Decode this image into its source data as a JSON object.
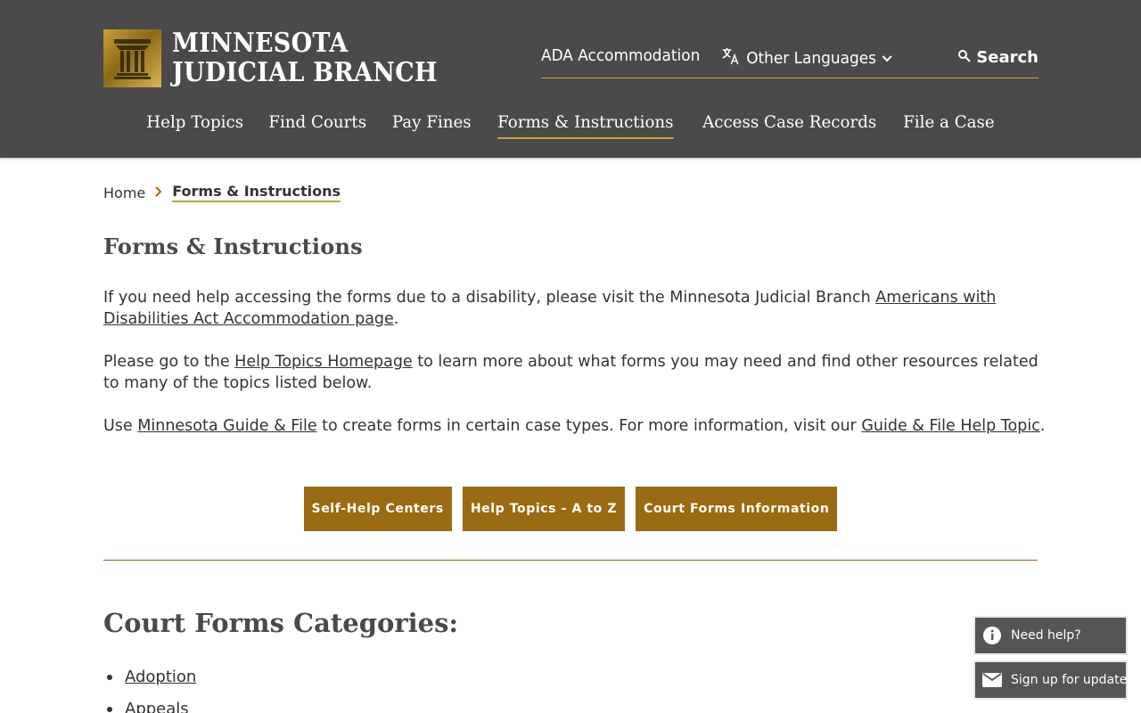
{
  "header": {
    "logo": {
      "line1": "MINNESOTA",
      "line2": "JUDICIAL BRANCH"
    },
    "utility": {
      "ada": "ADA Accommodation",
      "languages": "Other Languages",
      "search": "Search"
    },
    "nav": [
      {
        "label": "Help Topics"
      },
      {
        "label": "Find Courts"
      },
      {
        "label": "Pay Fines"
      },
      {
        "label": "Forms & Instructions",
        "active": true
      },
      {
        "label": "Access Case Records"
      },
      {
        "label": "File a Case"
      }
    ]
  },
  "breadcrumb": {
    "home": "Home",
    "current": "Forms & Instructions"
  },
  "page": {
    "title": "Forms & Instructions",
    "p1": {
      "text_before": "If you need help accessing the forms due to a disability, please visit the Minnesota Judicial Branch ",
      "link": "Americans with Disabilities Act Accommodation page",
      "text_after": "."
    },
    "p2": {
      "text_before": "Please go to the ",
      "link": "Help Topics Homepage",
      "text_after": " to learn more about what forms you may need and find other resources related to many of the topics listed below."
    },
    "p3": {
      "text_before": "Use ",
      "link1": "Minnesota Guide & File",
      "text_middle": " to create forms in certain case types. For more information, visit our ",
      "link2": "Guide & File Help Topic",
      "text_after": "."
    },
    "buttons": {
      "b1": "Self-Help Centers",
      "b2": "Help Topics - A to Z",
      "b3": "Court Forms Information"
    },
    "categories_title": "Court Forms Categories:",
    "categories": [
      "Adoption",
      "Appeals"
    ]
  },
  "widgets": {
    "help": "Need help?",
    "signup": "Sign up for updates"
  },
  "colors": {
    "header_bg": "#4a4a4a",
    "accent_gold": "#9a6b12",
    "underline_gold": "#c9a13a",
    "widget_bg": "#555555"
  },
  "icons": {
    "logo": "courthouse-pillar-icon",
    "languages": "translate-icon",
    "languages_caret": "chevron-down-icon",
    "search": "search-icon",
    "breadcrumb_separator": "chevron-right-icon",
    "help": "info-icon",
    "signup": "mail-icon"
  }
}
